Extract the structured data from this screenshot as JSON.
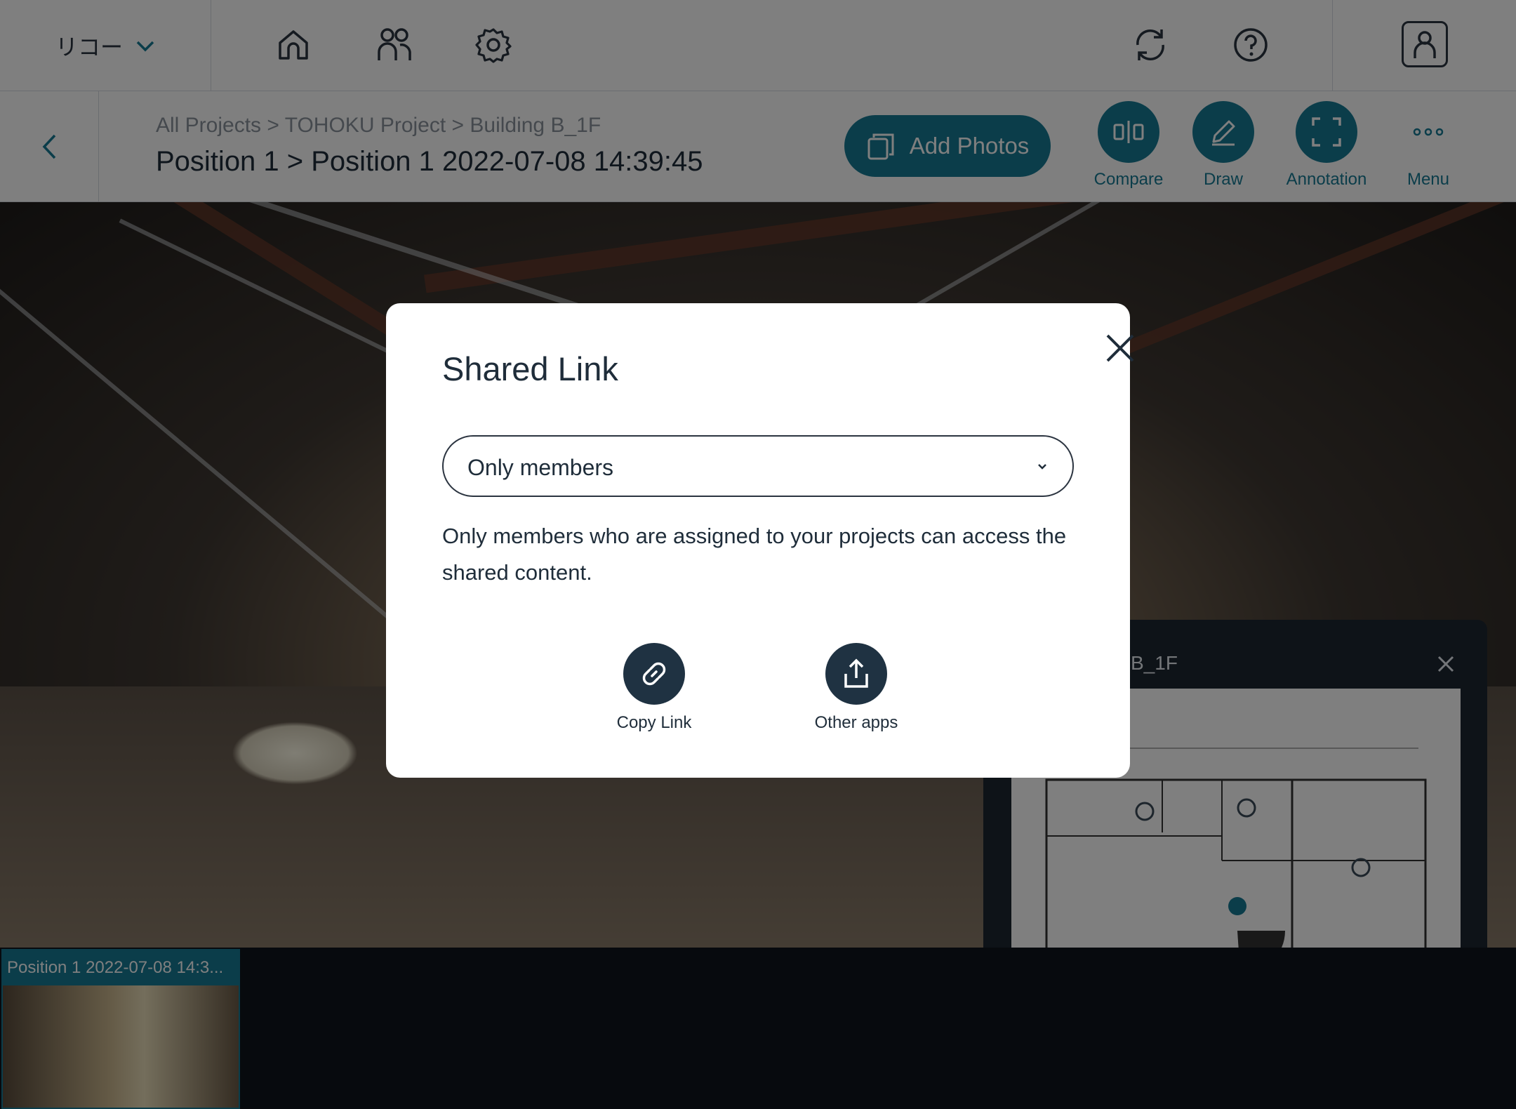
{
  "header": {
    "company": "リコー",
    "icons": [
      "home-icon",
      "people-icon",
      "settings-gear-icon",
      "sync-icon",
      "help-icon",
      "user-account-icon"
    ]
  },
  "subheader": {
    "breadcrumb": "All Projects > TOHOKU Project > Building B_1F",
    "title": "Position 1 > Position 1 2022-07-08 14:39:45",
    "add_photos_label": "Add Photos",
    "tools": {
      "compare": "Compare",
      "draw": "Draw",
      "annotation": "Annotation",
      "menu": "Menu"
    }
  },
  "minimap": {
    "title": "B_1F"
  },
  "filmstrip": {
    "items": [
      {
        "label": "Position 1 2022-07-08 14:3..."
      }
    ]
  },
  "modal": {
    "title": "Shared Link",
    "select_value": "Only members",
    "description": "Only members who are assigned to your projects can access the shared content.",
    "actions": {
      "copy_link": "Copy Link",
      "other_apps": "Other apps"
    }
  },
  "colors": {
    "accent": "#167a94",
    "dark_button": "#1f3242",
    "text": "#1f2d3a"
  }
}
